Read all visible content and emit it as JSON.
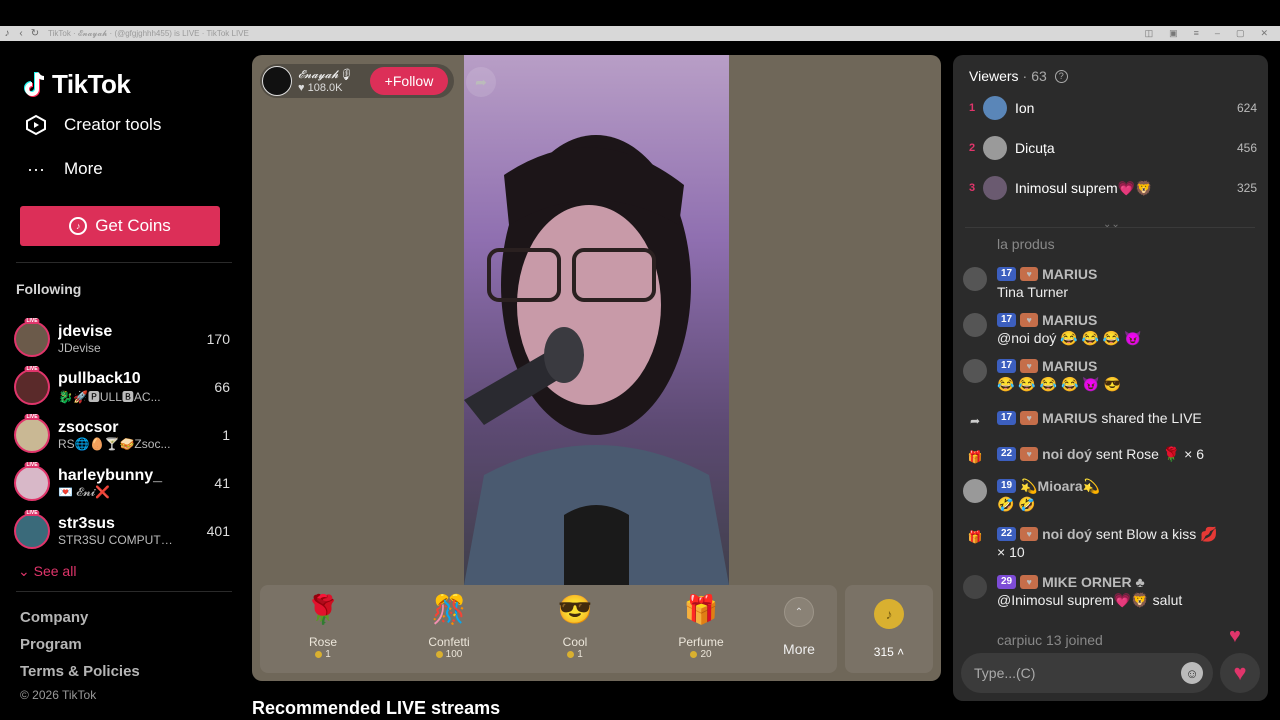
{
  "browser": {
    "title": "TikTok · 𝓔𝓷𝓪𝔂𝓪𝓱 · (@gfgjghhh455) is LIVE · TikTok LIVE"
  },
  "sidebar": {
    "logo_text": "TikTok",
    "nav": [
      {
        "label": "Creator tools",
        "icon": "creator-tools-icon"
      },
      {
        "label": "More",
        "icon": "more-dots-icon"
      }
    ],
    "get_coins_label": "Get Coins",
    "following_heading": "Following",
    "following": [
      {
        "name": "jdevise",
        "sub": "JDevise",
        "count": "170"
      },
      {
        "name": "pullback10",
        "sub": "🐉🚀🅿ULL🅱AC...",
        "count": "66"
      },
      {
        "name": "zsocsor",
        "sub": "RS🌐🥚🍸🥪Zsoc...",
        "count": "1"
      },
      {
        "name": "harleybunny_",
        "sub": "💌 𝓔𝓷𝓲❌",
        "count": "41"
      },
      {
        "name": "str3sus",
        "sub": "STR3SU COMPUTE...",
        "count": "401"
      }
    ],
    "see_all": "See all",
    "footer": [
      "Company",
      "Program",
      "Terms & Policies"
    ],
    "copyright": "© 2026 TikTok"
  },
  "live": {
    "host_name": "𝓔𝓷𝓪𝔂𝓪𝓱🎙",
    "host_likes": "108.0K",
    "follow_label": "Follow",
    "gifts": [
      {
        "name": "Rose",
        "price": "1",
        "emoji": "🌹"
      },
      {
        "name": "Confetti",
        "price": "100",
        "emoji": "🎊"
      },
      {
        "name": "Cool",
        "price": "1",
        "emoji": "😎"
      },
      {
        "name": "Perfume",
        "price": "20",
        "emoji": "🎁"
      }
    ],
    "more_label": "More",
    "balance": "315",
    "recommended_title": "Recommended LIVE streams"
  },
  "viewers": {
    "heading": "Viewers",
    "count": "63",
    "top": [
      {
        "rank": "1",
        "name": "Ion",
        "score": "624",
        "color": "#5a86b8"
      },
      {
        "rank": "2",
        "name": "Dicuța",
        "score": "456",
        "color": "#9a9a9a"
      },
      {
        "rank": "3",
        "name": "Inimosul suprem💗🦁",
        "score": "325",
        "color": "#6a5a70"
      }
    ]
  },
  "chat": {
    "messages": [
      {
        "type": "text",
        "text": "la produs"
      },
      {
        "type": "user",
        "level": "17",
        "user": "MARIUS",
        "text": "Tina Turner"
      },
      {
        "type": "user",
        "level": "17",
        "user": "MARIUS",
        "text": "@noi doý 😂 😂 😂 😈"
      },
      {
        "type": "user",
        "level": "17",
        "user": "MARIUS",
        "text": "😂 😂 😂 😂 😈 😎"
      },
      {
        "type": "share",
        "level": "17",
        "user": "MARIUS",
        "text": "shared the LIVE"
      },
      {
        "type": "gift",
        "level": "22",
        "user": "noi doý",
        "text": "sent Rose 🌹 × 6"
      },
      {
        "type": "user",
        "level": "19",
        "user": "💫Mioara💫",
        "text": "🤣 🤣"
      },
      {
        "type": "gift",
        "level": "22",
        "user": "noi doý",
        "text": "sent Blow a kiss 💋",
        "text2": "× 10"
      },
      {
        "type": "user",
        "level": "29",
        "user": "MIKE ORNER ♣",
        "text": "@Inimosul suprem💗🦁 salut"
      },
      {
        "type": "join",
        "text": "carpiuc 13  joined"
      }
    ],
    "input_placeholder": "Type...(C)"
  },
  "colors": {
    "accent": "#dc2f58",
    "panel": "#2b2b2b",
    "player_bg": "#6f6759"
  }
}
